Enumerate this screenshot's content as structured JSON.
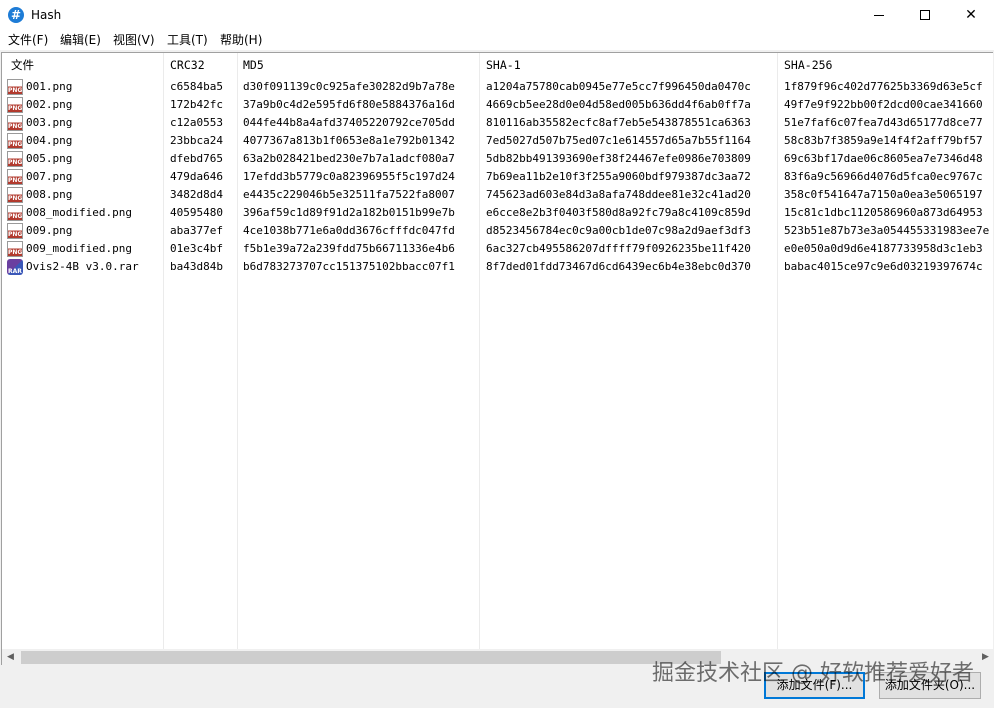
{
  "window": {
    "title": "Hash",
    "app_icon": "#",
    "minimize_label": "minimize",
    "close_glyph": "✕"
  },
  "menu": [
    "文件(F)",
    "编辑(E)",
    "视图(V)",
    "工具(T)",
    "帮助(H)"
  ],
  "columns": [
    "文件",
    "CRC32",
    "MD5",
    "SHA-1",
    "SHA-256"
  ],
  "rows": [
    {
      "name": "001.png",
      "type": "png",
      "crc32": "c6584ba5",
      "md5": "d30f091139c0c925afe30282d9b7a78e",
      "sha1": "a1204a75780cab0945e77e5cc7f996450da0470c",
      "sha256": "1f879f96c402d77625b3369d63e5cf"
    },
    {
      "name": "002.png",
      "type": "png",
      "crc32": "172b42fc",
      "md5": "37a9b0c4d2e595fd6f80e5884376a16d",
      "sha1": "4669cb5ee28d0e04d58ed005b636dd4f6ab0ff7a",
      "sha256": "49f7e9f922bb00f2dcd00cae341660"
    },
    {
      "name": "003.png",
      "type": "png",
      "crc32": "c12a0553",
      "md5": "044fe44b8a4afd37405220792ce705dd",
      "sha1": "810116ab35582ecfc8af7eb5e543878551ca6363",
      "sha256": "51e7faf6c07fea7d43d65177d8ce77"
    },
    {
      "name": "004.png",
      "type": "png",
      "crc32": "23bbca24",
      "md5": "4077367a813b1f0653e8a1e792b01342",
      "sha1": "7ed5027d507b75ed07c1e614557d65a7b55f1164",
      "sha256": "58c83b7f3859a9e14f4f2aff79bf57"
    },
    {
      "name": "005.png",
      "type": "png",
      "crc32": "dfebd765",
      "md5": "63a2b028421bed230e7b7a1adcf080a7",
      "sha1": "5db82bb491393690ef38f24467efe0986e703809",
      "sha256": "69c63bf17dae06c8605ea7e7346d48"
    },
    {
      "name": "007.png",
      "type": "png",
      "crc32": "479da646",
      "md5": "17efdd3b5779c0a82396955f5c197d24",
      "sha1": "7b69ea11b2e10f3f255a9060bdf979387dc3aa72",
      "sha256": "83f6a9c56966d4076d5fca0ec9767c"
    },
    {
      "name": "008.png",
      "type": "png",
      "crc32": "3482d8d4",
      "md5": "e4435c229046b5e32511fa7522fa8007",
      "sha1": "745623ad603e84d3a8afa748ddee81e32c41ad20",
      "sha256": "358c0f541647a7150a0ea3e5065197"
    },
    {
      "name": "008_modified.png",
      "type": "png",
      "crc32": "40595480",
      "md5": "396af59c1d89f91d2a182b0151b99e7b",
      "sha1": "e6cce8e2b3f0403f580d8a92fc79a8c4109c859d",
      "sha256": "15c81c1dbc1120586960a873d64953"
    },
    {
      "name": "009.png",
      "type": "png",
      "crc32": "aba377ef",
      "md5": "4ce1038b771e6a0dd3676cfffdc047fd",
      "sha1": "d8523456784ec0c9a00cb1de07c98a2d9aef3df3",
      "sha256": "523b51e87b73e3a054455331983ee7e"
    },
    {
      "name": "009_modified.png",
      "type": "png",
      "crc32": "01e3c4bf",
      "md5": "f5b1e39a72a239fdd75b66711336e4b6",
      "sha1": "6ac327cb495586207dffff79f0926235be11f420",
      "sha256": "e0e050a0d9d6e4187733958d3c1eb3"
    },
    {
      "name": "Ovis2-4B v3.0.rar",
      "type": "rar",
      "crc32": "ba43d84b",
      "md5": "b6d783273707cc151375102bbacc07f1",
      "sha1": "8f7ded01fdd73467d6cd6439ec6b4e38ebc0d370",
      "sha256": "babac4015ce97c9e6d03219397674c"
    }
  ],
  "icons": {
    "png": "PNG",
    "rar": "RAR"
  },
  "buttons": {
    "add_file": "添加文件(F)...",
    "add_folder": "添加文件夹(O)..."
  },
  "watermark": "掘金技术社区 @ 好软推荐爱好者"
}
